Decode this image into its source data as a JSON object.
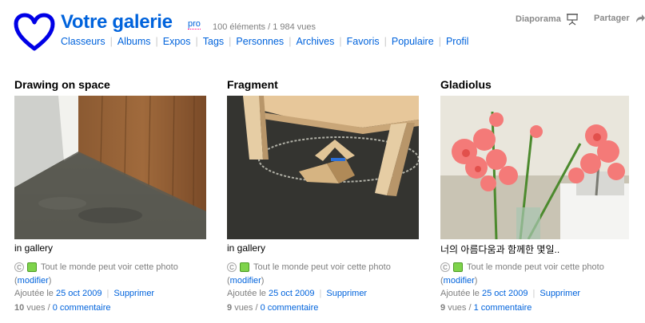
{
  "header": {
    "title": "Votre galerie",
    "badge": "pro",
    "stats": "100 éléments / 1 984 vues",
    "nav": [
      "Classeurs",
      "Albums",
      "Expos",
      "Tags",
      "Personnes",
      "Archives",
      "Favoris",
      "Populaire",
      "Profil"
    ],
    "slideshow": "Diaporama",
    "share": "Partager"
  },
  "colors": {
    "link": "#0063dc",
    "logo": "#0000e6",
    "public_box": "#7ed34b"
  },
  "photos": [
    {
      "title": "Drawing on space",
      "description": "in gallery",
      "permission": "Tout le monde peut voir cette photo",
      "modify": "modifier",
      "added_prefix": "Ajoutée le",
      "date": "25 oct 2009",
      "delete": "Supprimer",
      "views_count": "10",
      "views_label": "vues /",
      "comments": "0 commentaire"
    },
    {
      "title": "Fragment",
      "description": "in gallery",
      "permission": "Tout le monde peut voir cette photo",
      "modify": "modifier",
      "added_prefix": "Ajoutée le",
      "date": "25 oct 2009",
      "delete": "Supprimer",
      "views_count": "9",
      "views_label": "vues /",
      "comments": "0 commentaire"
    },
    {
      "title": "Gladiolus",
      "description": "너의 아름다움과 함께한 몇일..",
      "permission": "Tout le monde peut voir cette photo",
      "modify": "modifier",
      "added_prefix": "Ajoutée le",
      "date": "25 oct 2009",
      "delete": "Supprimer",
      "views_count": "9",
      "views_label": "vues /",
      "comments": "1 commentaire"
    }
  ]
}
